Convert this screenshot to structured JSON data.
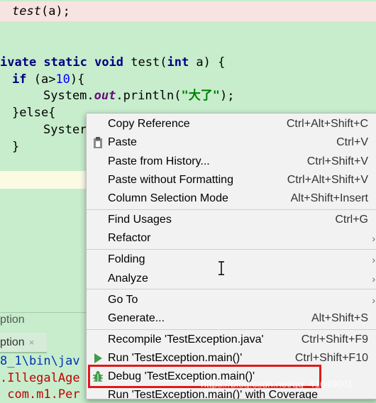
{
  "editor": {
    "line1": {
      "fn": "test",
      "rest": "(a);"
    },
    "line2": {
      "partial": "ivate ",
      "kw1": "static",
      "kw2": "void",
      "name": " test(",
      "kw3": "int",
      "rest": " a) {"
    },
    "line3": {
      "kw": "if",
      "pre": " (a>",
      "num": "10",
      "post": "){"
    },
    "line4": {
      "pre": "System.",
      "field": "out",
      "mid": ".println(",
      "str": "\"大了\"",
      "post": ");"
    },
    "line5": {
      "text": "}else{"
    },
    "line6": {
      "text": "Syster"
    },
    "line7": {
      "text": "}"
    }
  },
  "bottom": {
    "panel_title": "ption",
    "run_tab": "ption",
    "close": "×",
    "console": [
      "8_1\\bin\\jav",
      ".IllegalAge",
      " com.m1.Per"
    ]
  },
  "menu": {
    "items": [
      {
        "label": "Copy Reference",
        "shortcut": "Ctrl+Alt+Shift+C"
      },
      {
        "label": "Paste",
        "shortcut": "Ctrl+V"
      },
      {
        "label": "Paste from History...",
        "shortcut": "Ctrl+Shift+V"
      },
      {
        "label": "Paste without Formatting",
        "shortcut": "Ctrl+Alt+Shift+V"
      },
      {
        "label": "Column Selection Mode",
        "shortcut": "Alt+Shift+Insert"
      },
      {
        "label": "Find Usages",
        "shortcut": "Ctrl+G"
      },
      {
        "label": "Refactor",
        "shortcut": ""
      },
      {
        "label": "Folding",
        "shortcut": ""
      },
      {
        "label": "Analyze",
        "shortcut": ""
      },
      {
        "label": "Go To",
        "shortcut": ""
      },
      {
        "label": "Generate...",
        "shortcut": "Alt+Shift+S"
      },
      {
        "label": "Recompile 'TestException.java'",
        "shortcut": "Ctrl+Shift+F9"
      },
      {
        "label": "Run 'TestException.main()'",
        "shortcut": "Ctrl+Shift+F10"
      },
      {
        "label": "Debug 'TestException.main()'",
        "shortcut": ""
      },
      {
        "label": "Run 'TestException.main()' with Coverage",
        "shortcut": ""
      }
    ],
    "arrow": "›"
  },
  "watermark": "https://blog.csdn.net/qq_41649001",
  "colors": {
    "editor_bg": "#c7edcc",
    "menu_bg": "#f2f2f2",
    "highlight_box": "#e11919",
    "run_icon": "#3f9c4a",
    "debug_icon": "#3f9c4a"
  },
  "icons": [
    "paste-icon",
    "run-icon",
    "debug-icon",
    "submenu-arrow-icon"
  ]
}
